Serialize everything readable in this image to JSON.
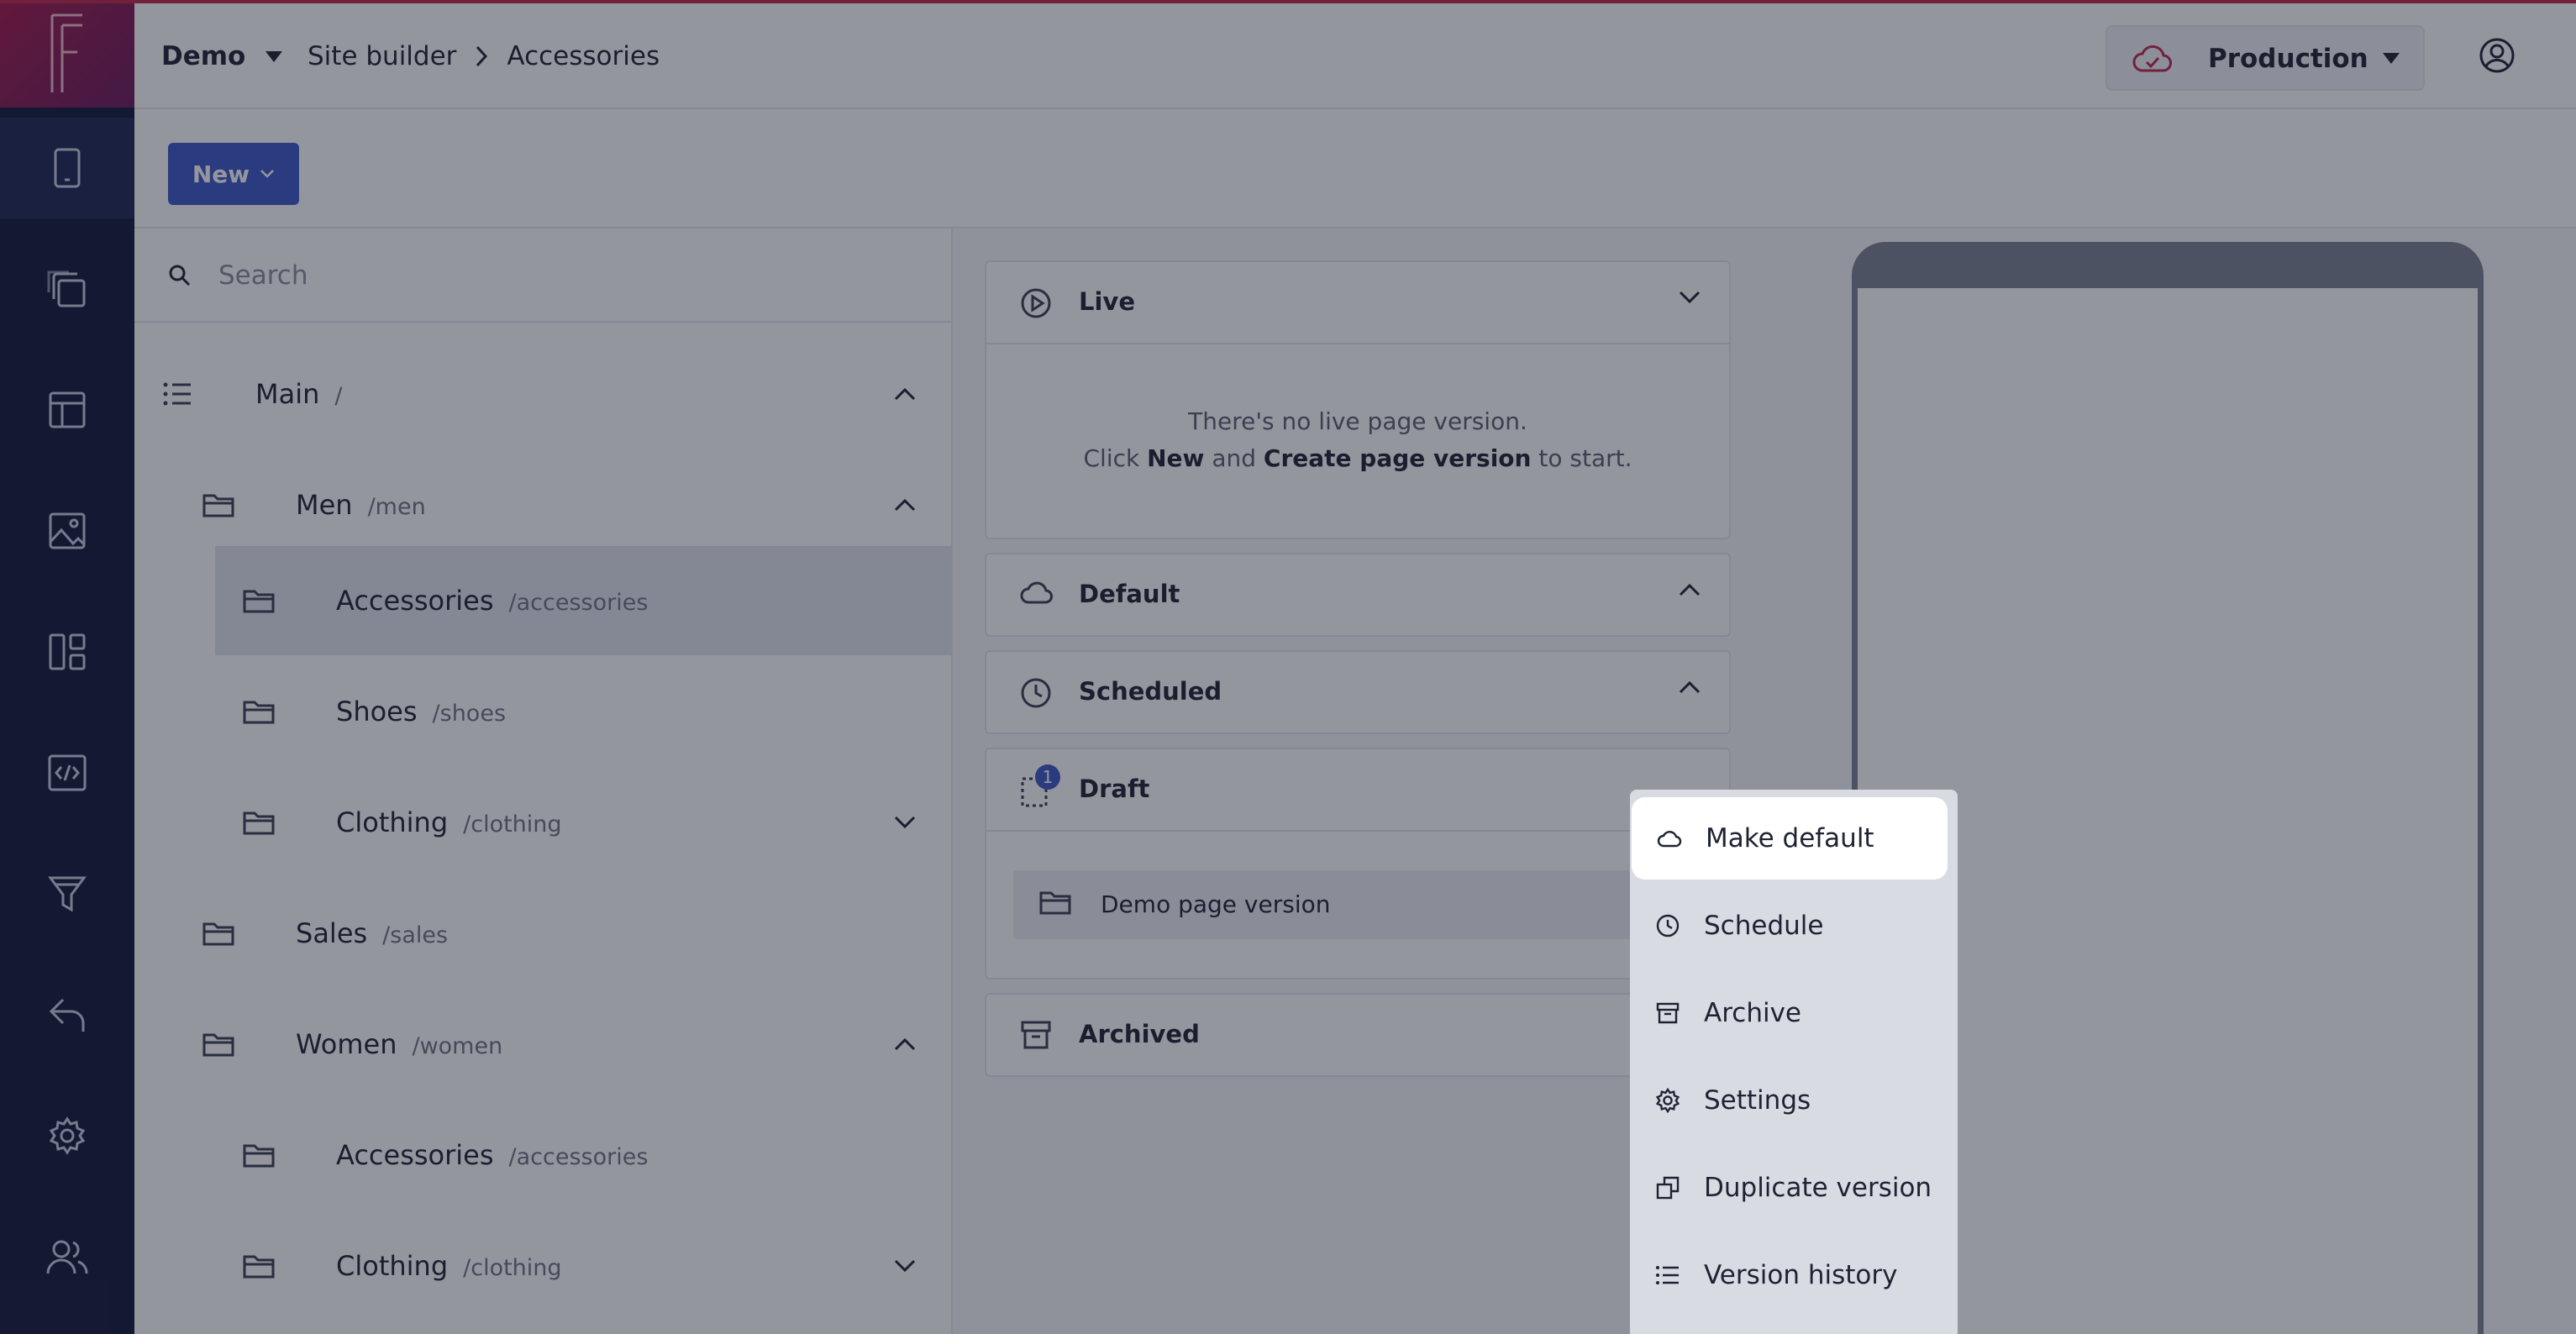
{
  "app": {
    "workspace": "Demo",
    "breadcrumb": [
      "Site builder",
      "Accessories"
    ],
    "environment": "Production"
  },
  "rail": {
    "items": [
      "pages-icon",
      "copy-icon",
      "layout-icon",
      "media-icon",
      "widgets-icon",
      "code-icon",
      "filter-icon",
      "undo-icon",
      "settings-icon",
      "users-icon"
    ]
  },
  "toolbar": {
    "new_label": "New"
  },
  "search": {
    "placeholder": "Search"
  },
  "tree": {
    "main": {
      "name": "Main",
      "path": "/"
    },
    "men": {
      "name": "Men",
      "path": "/men"
    },
    "men_accessories": {
      "name": "Accessories",
      "path": "/accessories"
    },
    "men_shoes": {
      "name": "Shoes",
      "path": "/shoes"
    },
    "men_clothing": {
      "name": "Clothing",
      "path": "/clothing"
    },
    "sales": {
      "name": "Sales",
      "path": "/sales"
    },
    "women": {
      "name": "Women",
      "path": "/women"
    },
    "women_accessories": {
      "name": "Accessories",
      "path": "/accessories"
    },
    "women_clothing": {
      "name": "Clothing",
      "path": "/clothing"
    }
  },
  "versions": {
    "live": {
      "title": "Live",
      "empty_line1": "There's no live page version.",
      "empty_click": "Click",
      "empty_new": "New",
      "empty_and": "and",
      "empty_create": "Create page version",
      "empty_end": "to start."
    },
    "default": {
      "title": "Default"
    },
    "scheduled": {
      "title": "Scheduled"
    },
    "draft": {
      "title": "Draft",
      "count": "1",
      "item": "Demo page version"
    },
    "archived": {
      "title": "Archived"
    }
  },
  "menu": {
    "make_default": "Make default",
    "schedule": "Schedule",
    "archive": "Archive",
    "settings": "Settings",
    "duplicate": "Duplicate version",
    "history": "Version history"
  },
  "colors": {
    "rail_bg": "#14193a",
    "logo_gradient_start": "#a4174a",
    "accent_blue": "#3e58c6",
    "production_cloud": "#c0284b"
  }
}
